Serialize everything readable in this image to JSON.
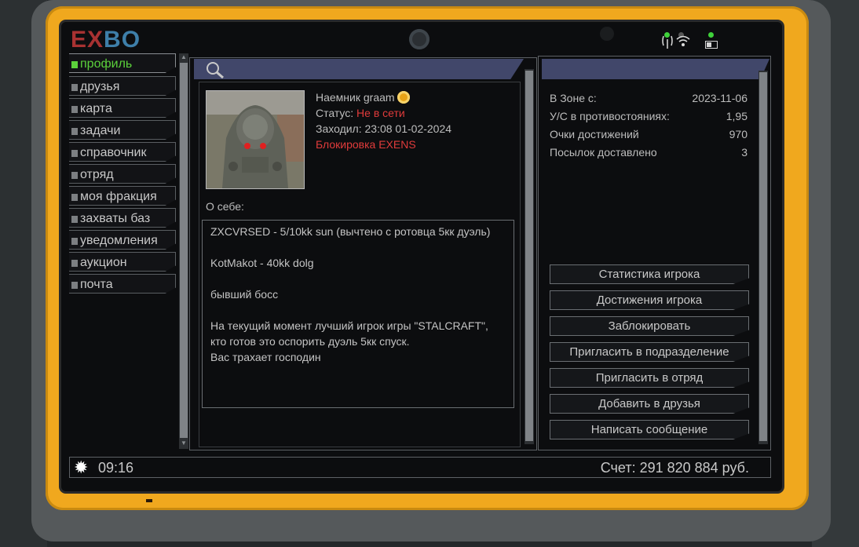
{
  "brand": {
    "logo_left": "EX",
    "logo_right": "BO"
  },
  "sidebar": {
    "items": [
      {
        "label": "профиль",
        "active": true
      },
      {
        "label": "друзья"
      },
      {
        "label": "карта"
      },
      {
        "label": "задачи"
      },
      {
        "label": "справочник"
      },
      {
        "label": "отряд"
      },
      {
        "label": "моя фракция"
      },
      {
        "label": "захваты баз"
      },
      {
        "label": "уведомления"
      },
      {
        "label": "аукцион"
      },
      {
        "label": "почта"
      }
    ]
  },
  "profile": {
    "name_line": "Наемник graam",
    "status_label": "Статус:",
    "status_value": "Не в сети",
    "last_seen": "Заходил: 23:08 01-02-2024",
    "block_note": "Блокировка EXENS",
    "about_label": "О себе:",
    "about_lines": [
      "ZXCVRSED - 5/10kk sun (вычтено с ротовца 5кк дуэль)",
      "KotMakot - 40kk dolg",
      "бывший босс",
      "На текущий момент лучший игрок игры \"STALCRAFT\", кто готов это оспорить дуэль 5кк спуск.\nВас трахает господин"
    ]
  },
  "stats": [
    {
      "label": "В Зоне с:",
      "value": "2023-11-06"
    },
    {
      "label": "У/С в противостояниях:",
      "value": "1,95"
    },
    {
      "label": "Очки достижений",
      "value": "970"
    },
    {
      "label": "Посылок доставлено",
      "value": "3"
    }
  ],
  "actions": [
    "Статистика игрока",
    "Достижения игрока",
    "Заблокировать",
    "Пригласить в подразделение",
    "Пригласить в отряд",
    "Добавить в друзья",
    "Написать сообщение"
  ],
  "statusbar": {
    "time": "09:16",
    "account": "Счет: 291 820 884 руб."
  },
  "icons": {
    "search": "magnifier-icon",
    "sun": "sun-icon",
    "wifi": "signal-icon",
    "battery": "battery-icon"
  },
  "colors": {
    "accent_green": "#5bd13b",
    "alert_red": "#e03b3b",
    "frame_yellow": "#f0a81e",
    "header_bar": "#41476a"
  }
}
